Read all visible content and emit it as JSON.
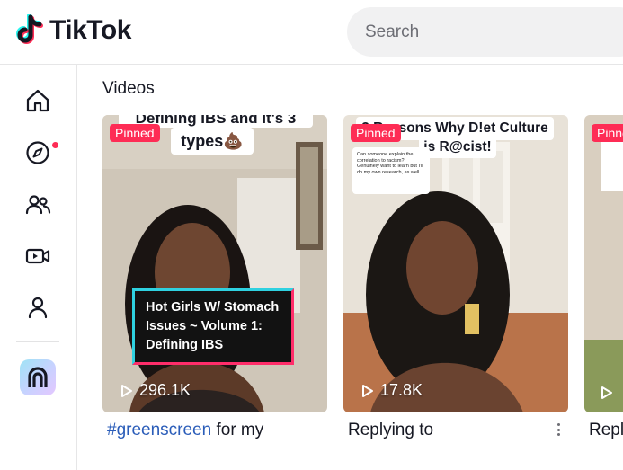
{
  "app": {
    "name": "TikTok"
  },
  "search": {
    "placeholder": "Search"
  },
  "colors": {
    "brand_red": "#fe2c55",
    "brand_cyan": "#25f4ee",
    "link_blue": "#2b5db9"
  },
  "sidebar": {
    "items": [
      {
        "icon": "home-icon"
      },
      {
        "icon": "explore-compass-icon",
        "has_notification": true
      },
      {
        "icon": "following-users-icon"
      },
      {
        "icon": "live-video-icon"
      },
      {
        "icon": "profile-icon"
      }
    ],
    "creator_icon": "creator-tools-icon"
  },
  "main": {
    "section_title": "Videos",
    "videos": [
      {
        "pinned_label": "Pinned",
        "overlay_title_line1": "Defining IBS and it's 3",
        "overlay_title_line2": "types💩",
        "lower_third": "Hot Girls W/ Stomach Issues ~ Volume 1: Defining IBS",
        "views": "296.1K",
        "caption_hashtag": "#greenscreen",
        "caption_rest": " for my"
      },
      {
        "pinned_label": "Pinned",
        "overlay_title_line1": "3 Reasons Why D!et Culture",
        "overlay_title_line2": "is R@cist!",
        "comment_text": "Can someone explain the correlation to racism? Genuinely want to learn but I'll do my own research, as well.",
        "views": "17.8K",
        "caption": "Replying to"
      },
      {
        "pinned_label": "Pinned",
        "views": "",
        "caption": "Repl"
      }
    ]
  }
}
